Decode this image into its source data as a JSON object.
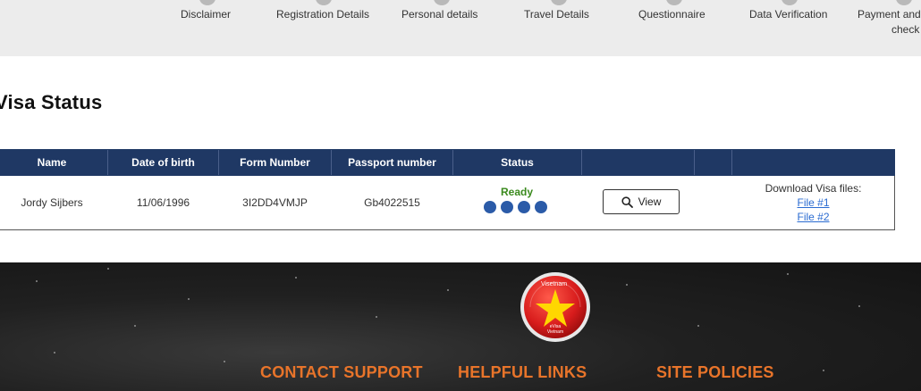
{
  "steps": [
    {
      "label": "Disclaimer"
    },
    {
      "label": "Registration Details"
    },
    {
      "label": "Personal details"
    },
    {
      "label": "Travel Details"
    },
    {
      "label": "Questionnaire"
    },
    {
      "label": "Data Verification"
    },
    {
      "label_line1": "Payment and",
      "label_line2": "check"
    }
  ],
  "page_title": "Visa Status",
  "table": {
    "headers": [
      "Name",
      "Date of birth",
      "Form Number",
      "Passport number",
      "Status",
      "",
      "",
      ""
    ],
    "row": {
      "name": "Jordy Sijbers",
      "dob": "11/06/1996",
      "form_number": "3I2DD4VMJP",
      "passport": "Gb4022515",
      "status": "Ready",
      "status_color": "#3a8a1d",
      "progress_steps_completed": 4,
      "view_label": "View",
      "download_label": "Download Visa files:",
      "files": [
        "File #1",
        "File #2"
      ]
    }
  },
  "footer": {
    "logo_top_text": "Visetnam",
    "logo_bottom_text": "eVisa\nVietnam",
    "headings": [
      "CONTACT SUPPORT",
      "HELPFUL LINKS",
      "SITE POLICIES"
    ],
    "heading_color": "#e8742a"
  },
  "colors": {
    "header_bg": "#1f3864",
    "dot_blue": "#2b5ba8",
    "link": "#2a6bd1"
  }
}
